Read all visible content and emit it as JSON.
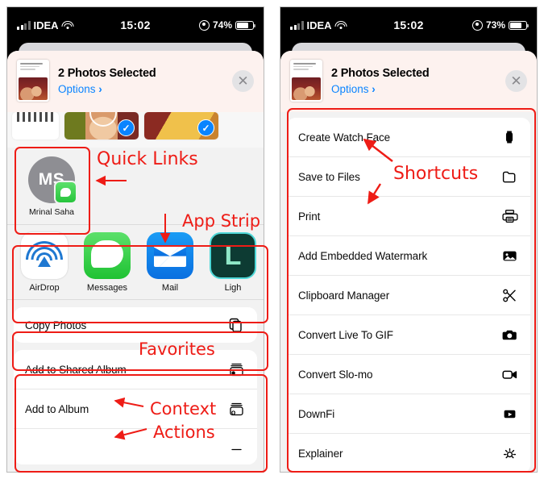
{
  "panels": [
    {
      "id": "left",
      "status": {
        "carrier": "IDEA",
        "time": "15:02",
        "battery": "74%",
        "signal_icon": "cellular-bars-icon",
        "wifi_icon": "wifi-icon",
        "lock_icon": "rotation-lock-icon",
        "battery_icon": "battery-icon"
      },
      "sheet": {
        "title": "2 Photos Selected",
        "options_label": "Options",
        "options_chevron": "›",
        "close_icon": "close-icon",
        "close_glyph": "✕",
        "thumbnail_icon": "photo-thumbnail"
      },
      "photos": [
        {
          "name": "photo-card-document",
          "selected": false
        },
        {
          "name": "photo-card-1",
          "selected": true
        },
        {
          "name": "photo-card-2",
          "selected": true
        }
      ],
      "quick_links": [
        {
          "initials": "MS",
          "name": "Mrinal Saha",
          "app_badge": "messages-badge-icon"
        }
      ],
      "apps": [
        {
          "label": "AirDrop",
          "icon": "airdrop-icon"
        },
        {
          "label": "Messages",
          "icon": "messages-icon"
        },
        {
          "label": "Mail",
          "icon": "mail-icon"
        },
        {
          "label": "Ligh",
          "icon": "lightroom-icon"
        }
      ],
      "favorites": [
        {
          "label": "Copy Photos",
          "icon": "copy-icon"
        }
      ],
      "context_actions": [
        {
          "label": "Add to Shared Album",
          "icon": "shared-album-icon"
        },
        {
          "label": "Add to Album",
          "icon": "add-album-icon"
        },
        {
          "label": "",
          "icon": "partial-row-icon"
        }
      ]
    },
    {
      "id": "right",
      "status": {
        "carrier": "IDEA",
        "time": "15:02",
        "battery": "73%",
        "signal_icon": "cellular-bars-icon",
        "wifi_icon": "wifi-icon",
        "lock_icon": "rotation-lock-icon",
        "battery_icon": "battery-icon"
      },
      "sheet": {
        "title": "2 Photos Selected",
        "options_label": "Options",
        "options_chevron": "›",
        "close_icon": "close-icon",
        "close_glyph": "✕",
        "thumbnail_icon": "photo-thumbnail"
      },
      "shortcuts": [
        {
          "label": "Create Watch Face",
          "icon": "watch-icon"
        },
        {
          "label": "Save to Files",
          "icon": "folder-icon"
        },
        {
          "label": "Print",
          "icon": "printer-icon"
        },
        {
          "label": "Add Embedded Watermark",
          "icon": "image-icon"
        },
        {
          "label": "Clipboard Manager",
          "icon": "scissors-icon"
        },
        {
          "label": "Convert Live To GIF",
          "icon": "camera-icon"
        },
        {
          "label": "Convert Slo-mo",
          "icon": "video-icon"
        },
        {
          "label": "DownFi",
          "icon": "play-icon"
        },
        {
          "label": "Explainer",
          "icon": "sparkle-icon"
        }
      ]
    }
  ],
  "annotations": {
    "color": "#ee1c16",
    "labels": [
      {
        "id": "quick-links",
        "text": "Quick Links"
      },
      {
        "id": "app-strip",
        "text": "App Strip"
      },
      {
        "id": "favorites",
        "text": "Favorites"
      },
      {
        "id": "context",
        "text": "Context"
      },
      {
        "id": "actions",
        "text": "Actions"
      },
      {
        "id": "shortcuts",
        "text": "Shortcuts"
      }
    ]
  }
}
